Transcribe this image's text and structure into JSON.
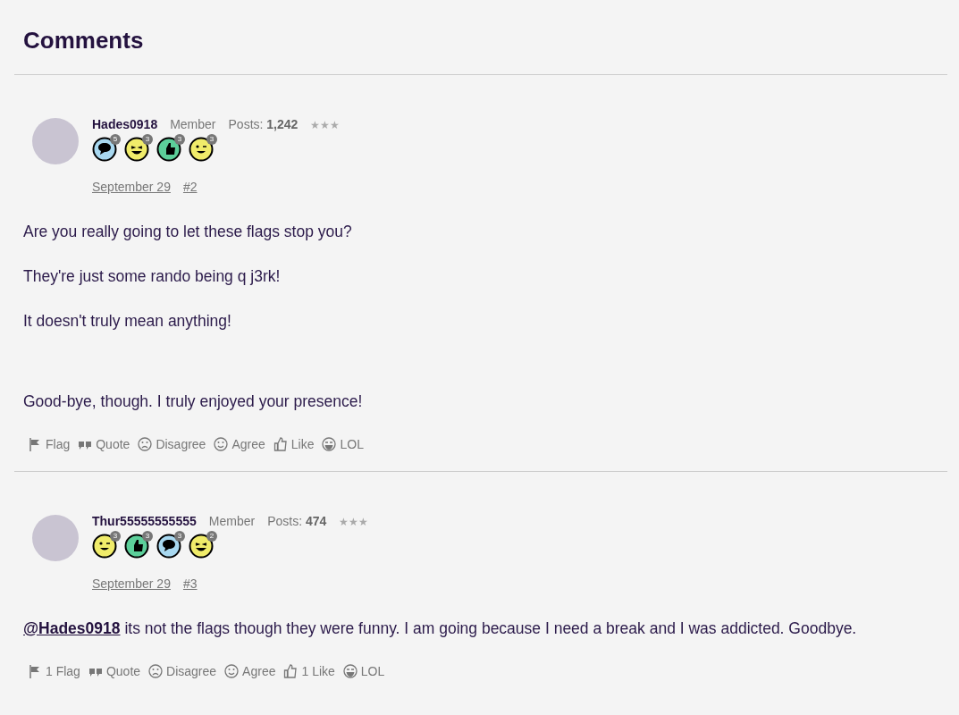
{
  "title": "Comments",
  "comments": [
    {
      "author": "Hades0918",
      "role": "Member",
      "posts_label": "Posts:",
      "posts": "1,242",
      "rank": "★★★",
      "badges": [
        {
          "kind": "comment",
          "count": "5"
        },
        {
          "kind": "laugh",
          "count": "3"
        },
        {
          "kind": "like",
          "count": "3"
        },
        {
          "kind": "wink",
          "count": "3"
        }
      ],
      "date": "September 29",
      "number": "#2",
      "paragraphs": [
        {
          "kind": "text",
          "text": "Are you really going to let these flags stop you?"
        },
        {
          "kind": "text",
          "text": "They're just some rando being q j3rk!"
        },
        {
          "kind": "text",
          "text": "It doesn't truly mean anything!"
        },
        {
          "kind": "blank"
        },
        {
          "kind": "text",
          "text": "Good-bye, though. I truly enjoyed your presence!"
        }
      ],
      "actions": [
        {
          "kind": "flag",
          "label": "Flag"
        },
        {
          "kind": "quote",
          "label": "Quote"
        },
        {
          "kind": "disagree",
          "label": "Disagree"
        },
        {
          "kind": "agree",
          "label": "Agree"
        },
        {
          "kind": "like",
          "label": "Like"
        },
        {
          "kind": "lol",
          "label": "LOL"
        }
      ]
    },
    {
      "author": "Thur55555555555",
      "role": "Member",
      "posts_label": "Posts:",
      "posts": "474",
      "rank": "★★★",
      "badges": [
        {
          "kind": "wink",
          "count": "3"
        },
        {
          "kind": "like",
          "count": "3"
        },
        {
          "kind": "comment",
          "count": "3"
        },
        {
          "kind": "laugh",
          "count": "2"
        }
      ],
      "date": "September 29",
      "number": "#3",
      "paragraphs": [
        {
          "kind": "text",
          "mention": "@Hades0918",
          "text": "its not the flags though they were funny. I am going because I need a break and I was addicted. Goodbye."
        }
      ],
      "actions": [
        {
          "kind": "flag",
          "label": "1 Flag"
        },
        {
          "kind": "quote",
          "label": "Quote"
        },
        {
          "kind": "disagree",
          "label": "Disagree"
        },
        {
          "kind": "agree",
          "label": "Agree"
        },
        {
          "kind": "like",
          "label": "1 Like"
        },
        {
          "kind": "lol",
          "label": "LOL"
        }
      ]
    }
  ]
}
